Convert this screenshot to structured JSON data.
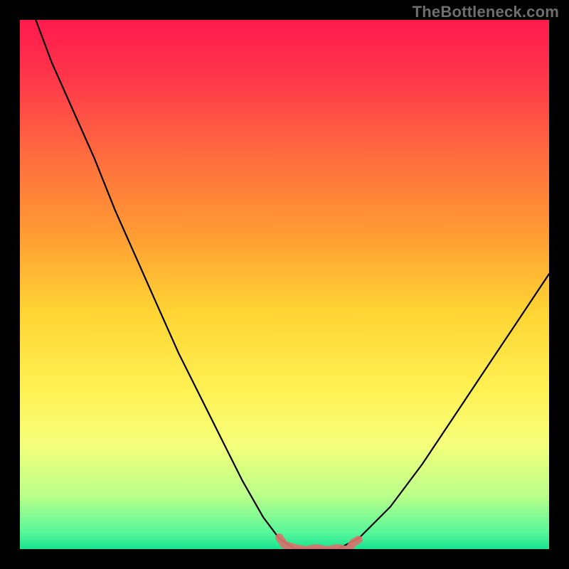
{
  "watermark": "TheBottleneck.com",
  "chart_data": {
    "type": "line",
    "title": "",
    "xlabel": "",
    "ylabel": "",
    "xlim": [
      0,
      100
    ],
    "ylim": [
      0,
      100
    ],
    "grid": false,
    "legend": false,
    "series": [
      {
        "name": "bottleneck-curve",
        "color": "#000000",
        "x": [
          3,
          6,
          10,
          14,
          18,
          22,
          26,
          30,
          34,
          38,
          42,
          46,
          49,
          52,
          56,
          60,
          64,
          70,
          76,
          82,
          88,
          94,
          100
        ],
        "y": [
          100,
          92,
          83,
          74,
          64,
          55,
          46,
          37,
          29,
          21,
          13,
          6,
          2,
          0,
          0,
          0,
          2,
          8,
          16,
          25,
          34,
          43,
          52
        ]
      },
      {
        "name": "optimal-band-marker",
        "color": "#d9726a",
        "x": [
          49,
          50,
          52,
          54,
          56,
          58,
          60,
          62,
          63,
          64
        ],
        "y": [
          2,
          1,
          0,
          0,
          0,
          0,
          0,
          0,
          1,
          2
        ]
      }
    ],
    "background": {
      "type": "vertical-gradient",
      "stops": [
        {
          "pos": 0.0,
          "color": "#ff1a4e"
        },
        {
          "pos": 0.12,
          "color": "#ff3a4a"
        },
        {
          "pos": 0.25,
          "color": "#ff6a3f"
        },
        {
          "pos": 0.4,
          "color": "#ff9a33"
        },
        {
          "pos": 0.55,
          "color": "#ffd433"
        },
        {
          "pos": 0.7,
          "color": "#fff154"
        },
        {
          "pos": 0.8,
          "color": "#f6ff7a"
        },
        {
          "pos": 0.9,
          "color": "#b9ff8a"
        },
        {
          "pos": 0.97,
          "color": "#55f79a"
        },
        {
          "pos": 1.0,
          "color": "#18e28f"
        }
      ]
    }
  }
}
